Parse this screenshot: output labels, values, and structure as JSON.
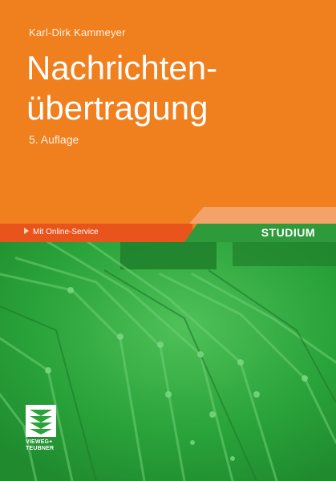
{
  "book": {
    "author": "Karl-Dirk Kammeyer",
    "title_line1": "Nachrichten-",
    "title_line2": "übertragung",
    "edition": "5. Auflage"
  },
  "band": {
    "online_service": "Mit Online-Service",
    "series": "STUDIUM"
  },
  "publisher": {
    "logo_line1": "VIEWEG+",
    "logo_line2": "TEUBNER"
  },
  "colors": {
    "cover_orange": "#f07f1d",
    "band_orange": "#e8541c",
    "band_green": "#2f9a3c",
    "photo_green": "#2aa33a"
  }
}
